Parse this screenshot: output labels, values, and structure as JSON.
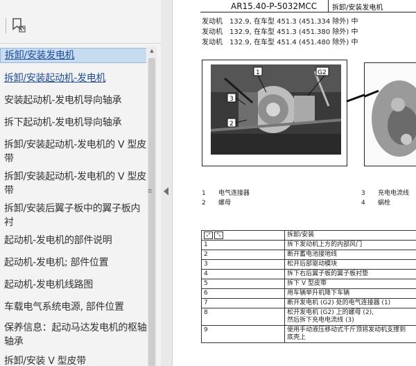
{
  "toc": {
    "items": [
      {
        "label": "拆卸/安装发电机",
        "style": "active"
      },
      {
        "label": "拆卸/安装起动机-发电机",
        "style": "link"
      },
      {
        "label": "安装起动机-发电机导向轴承",
        "style": "plain"
      },
      {
        "label": "拆下起动机-发电机导向轴承",
        "style": "plain"
      },
      {
        "label": "拆卸/安装起动机-发电机的 V 型皮带",
        "style": "plain"
      },
      {
        "label": "拆卸/安装起动机-发电机的 V 型皮带",
        "style": "plain"
      },
      {
        "label": "拆卸/安装后翼子板中的翼子板内衬",
        "style": "plain"
      },
      {
        "label": "起动机-发电机的部件说明",
        "style": "plain"
      },
      {
        "label": "起动机-发电机; 部件位置",
        "style": "plain"
      },
      {
        "label": "起动机-发电机线路图",
        "style": "plain"
      },
      {
        "label": "车载电气系统电源, 部件位置",
        "style": "plain"
      },
      {
        "label": "保养信息：起动马达发电机的枢轴轴承",
        "style": "plain"
      },
      {
        "label": "拆卸/安装 V 型皮带",
        "style": "plain"
      }
    ]
  },
  "doc": {
    "code": "AR15.40-P-5032MCC",
    "section": "拆卸/安装发电机",
    "applicability": [
      {
        "engine": "发动机",
        "text": "132.9, 在车型 451.3 (451.334 除外) 中"
      },
      {
        "engine": "发动机",
        "text": "132.9, 在车型 451.3 (451.380 除外) 中"
      },
      {
        "engine": "发动机",
        "text": "132.9, 在车型 451.4 (451.480 除外) 中"
      }
    ],
    "callouts": [
      "1",
      "G2",
      "3",
      "2"
    ],
    "legend": [
      {
        "n": "1",
        "label": "电气连接器"
      },
      {
        "n": "2",
        "label": "螺母"
      },
      {
        "n": "3",
        "label": "充电电流线"
      },
      {
        "n": "4",
        "label": "蜗栓"
      }
    ],
    "table": {
      "header": "拆卸/安装",
      "rows": [
        {
          "n": "1",
          "text": "拆下发动机上方的内部风门"
        },
        {
          "n": "2",
          "text": "断开蓄电池接地线"
        },
        {
          "n": "3",
          "text": "松开后部驱动模块"
        },
        {
          "n": "4",
          "text": "拆下右后翼子板的翼子板衬垫"
        },
        {
          "n": "5",
          "text": "拆下 V 型皮带"
        },
        {
          "n": "6",
          "text": "用车辆举升机降下车辆"
        },
        {
          "n": "7",
          "text": "断开发电机 (G2) 处的电气连接器 (1)"
        },
        {
          "n": "8",
          "text": "松开发电机 (G2) 上的螺母 (2),",
          "text2": "然后拆下充电电流线 (3)"
        },
        {
          "n": "9",
          "text": "使用手动液压移动式千斤顶将发动机支撑到",
          "text2": "底壳上"
        }
      ]
    }
  }
}
